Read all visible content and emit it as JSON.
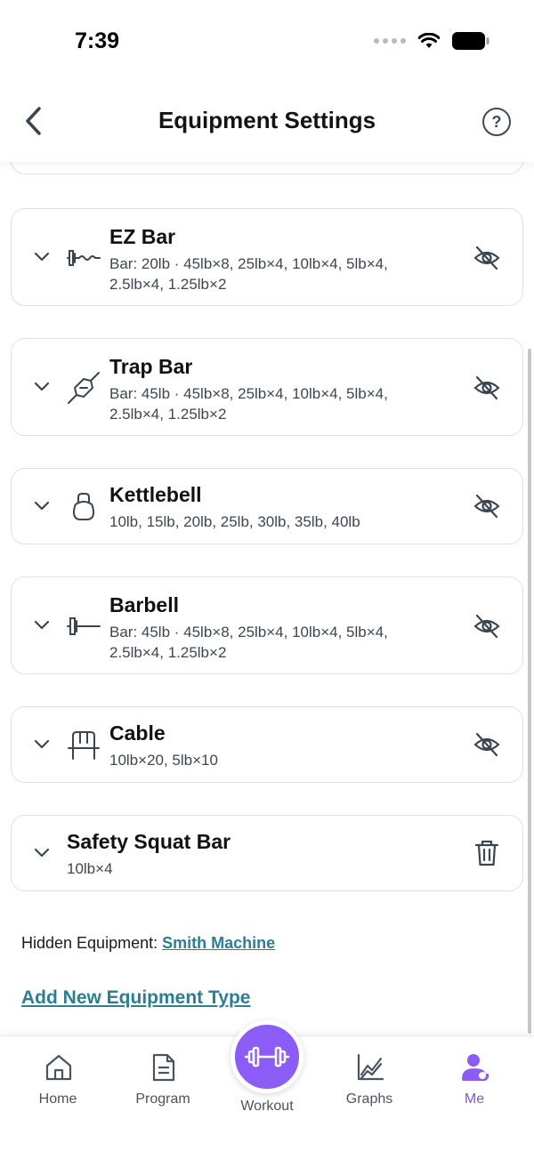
{
  "status": {
    "time": "7:39"
  },
  "header": {
    "title": "Equipment Settings",
    "help_label": "?"
  },
  "equipment": [
    {
      "name": "EZ Bar",
      "detail_line1": "Bar: 20lb · 45lb×8, 25lb×4, 10lb×4, 5lb×4,",
      "detail_line2": "2.5lb×4, 1.25lb×2",
      "icon": "ez-bar-icon",
      "action": "hide"
    },
    {
      "name": "Trap Bar",
      "detail_line1": "Bar: 45lb · 45lb×8, 25lb×4, 10lb×4, 5lb×4,",
      "detail_line2": "2.5lb×4, 1.25lb×2",
      "icon": "trap-bar-icon",
      "action": "hide"
    },
    {
      "name": "Kettlebell",
      "detail_line1": "10lb, 15lb, 20lb, 25lb, 30lb, 35lb, 40lb",
      "detail_line2": "",
      "icon": "kettlebell-icon",
      "action": "hide"
    },
    {
      "name": "Barbell",
      "detail_line1": "Bar: 45lb · 45lb×8, 25lb×4, 10lb×4, 5lb×4,",
      "detail_line2": "2.5lb×4, 1.25lb×2",
      "icon": "barbell-icon",
      "action": "hide"
    },
    {
      "name": "Cable",
      "detail_line1": "10lb×20, 5lb×10",
      "detail_line2": "",
      "icon": "cable-icon",
      "action": "hide"
    },
    {
      "name": "Safety Squat Bar",
      "detail_line1": "10lb×4",
      "detail_line2": "",
      "icon": "",
      "action": "delete"
    }
  ],
  "hidden_equipment": {
    "label": "Hidden Equipment:",
    "link": "Smith Machine"
  },
  "add_link": "Add New Equipment Type",
  "tabs": [
    {
      "label": "Home",
      "icon": "home-icon"
    },
    {
      "label": "Program",
      "icon": "document-icon"
    },
    {
      "label": "Workout",
      "icon": "dumbbell-icon"
    },
    {
      "label": "Graphs",
      "icon": "chart-icon"
    },
    {
      "label": "Me",
      "icon": "user-icon"
    }
  ],
  "colors": {
    "accent": "#8b5cf6",
    "link": "#2a7f92",
    "active_tab": "#7c57d6"
  }
}
